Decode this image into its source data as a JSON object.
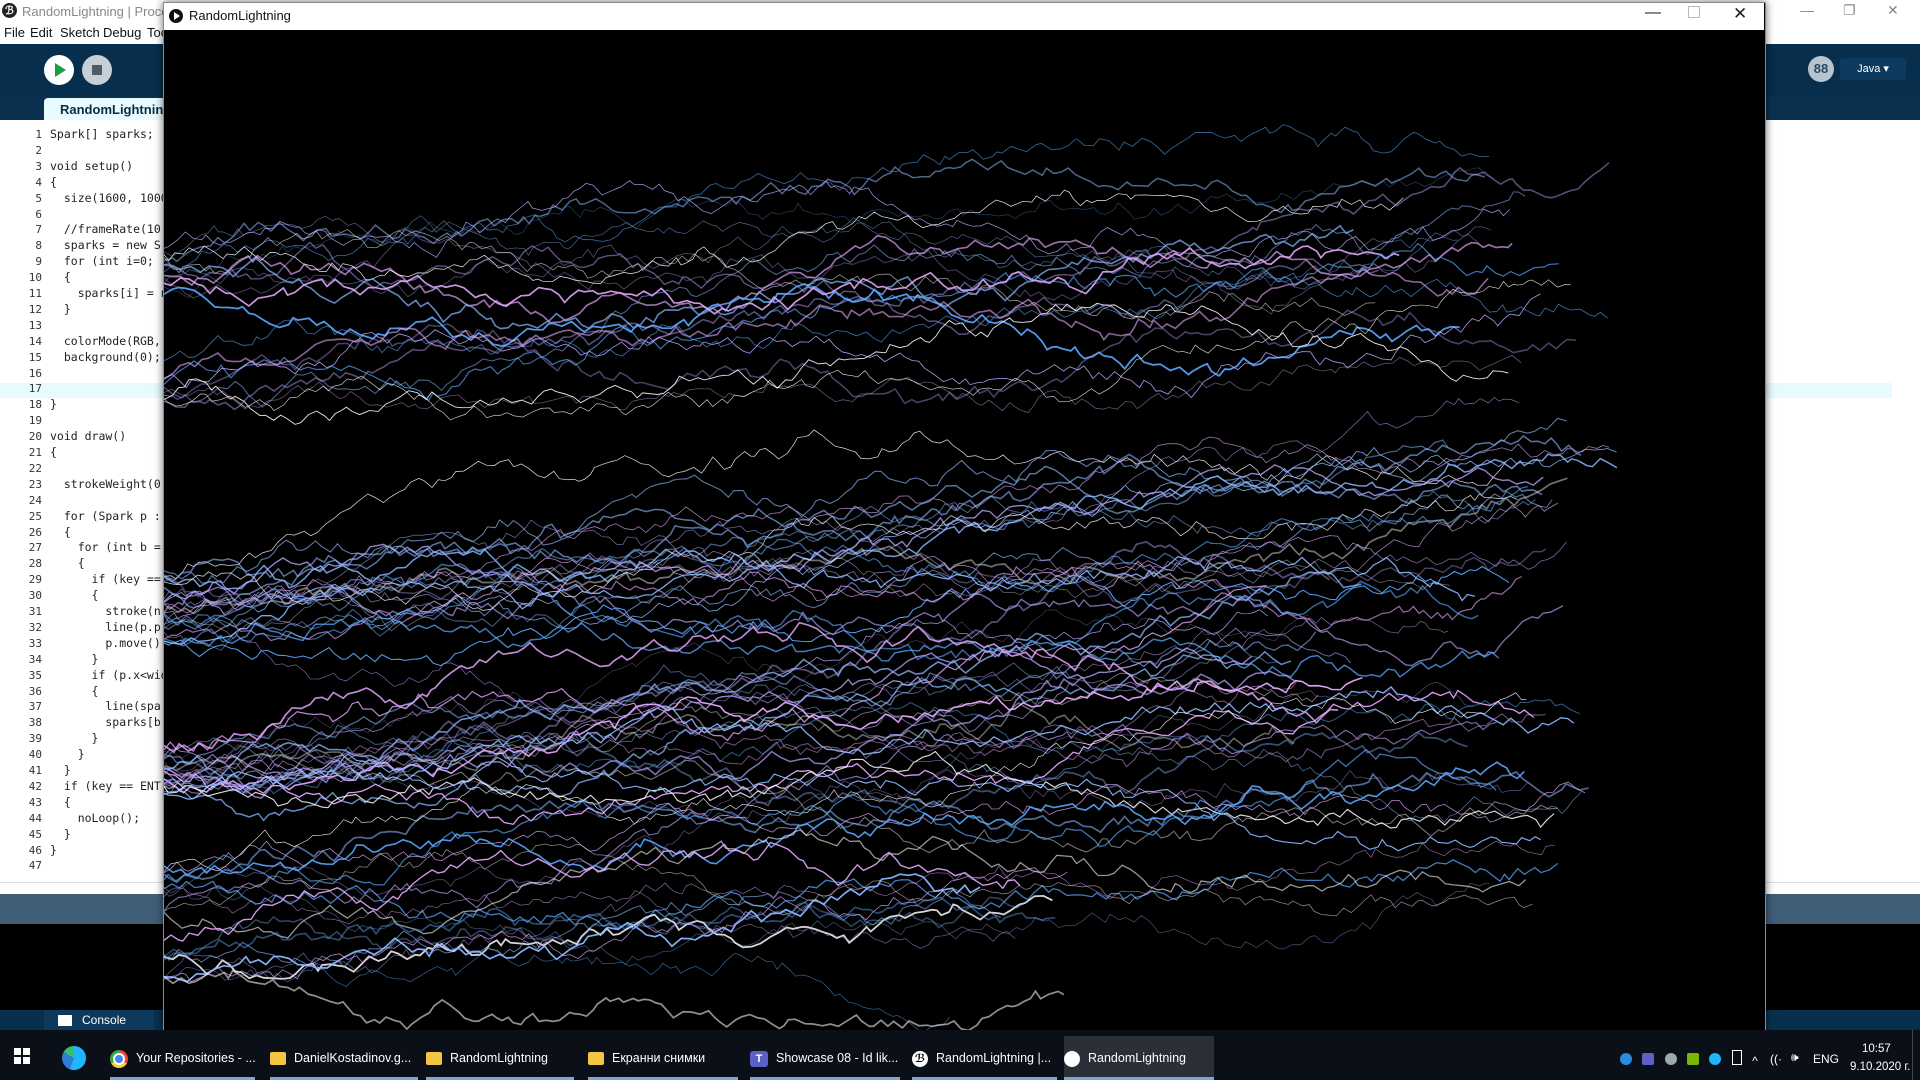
{
  "ide": {
    "title": "RandomLightning | Processing",
    "menu": [
      "File",
      "Edit",
      "Sketch",
      "Debug",
      "Tools"
    ],
    "tab_label": "RandomLightning",
    "mode_label": "Java ▾",
    "mode_icon": "88",
    "code_lines": [
      "Spark[] sparks;",
      "",
      "void setup()",
      "{",
      "  size(1600, 1000",
      "",
      "  //frameRate(10",
      "  sparks = new S",
      "  for (int i=0;",
      "  {",
      "    sparks[i] = n",
      "  }",
      "",
      "  colorMode(RGB,",
      "  background(0);",
      "",
      "",
      "}",
      "",
      "void draw()",
      "{",
      "",
      "  strokeWeight(0",
      "",
      "  for (Spark p :",
      "  {",
      "    for (int b =",
      "    {",
      "      if (key ==",
      "      {",
      "        stroke(n",
      "        line(p.p",
      "        p.move()",
      "      }",
      "      if (p.x<wid",
      "      {",
      "        line(spa",
      "        sparks[b",
      "      }",
      "    }",
      "  }",
      "  if (key == ENT",
      "  {",
      "    noLoop();",
      "  }",
      "}",
      ""
    ],
    "console_tab": "Console"
  },
  "sketch": {
    "window_title": "RandomLightning",
    "background": "#000000",
    "bolt_colors": [
      "#8ab8ff",
      "#e6a8ff",
      "#5aa8ff",
      "#b9a6ff",
      "#ffffff"
    ]
  },
  "taskbar": {
    "items": [
      {
        "label": "Your Repositories - ...",
        "icon": "chrome-icon"
      },
      {
        "label": "DanielKostadinov.g...",
        "icon": "folder-icon"
      },
      {
        "label": "RandomLightning",
        "icon": "folder-icon"
      },
      {
        "label": "Екранни снимки",
        "icon": "folder-icon"
      },
      {
        "label": "Showcase 08 - Id lik...",
        "icon": "teams-icon"
      },
      {
        "label": "RandomLightning |...",
        "icon": "processing-icon"
      },
      {
        "label": "RandomLightning",
        "icon": "sketch-icon"
      }
    ],
    "lang": "ENG",
    "time": "10:57",
    "date": "9.10.2020 г."
  }
}
